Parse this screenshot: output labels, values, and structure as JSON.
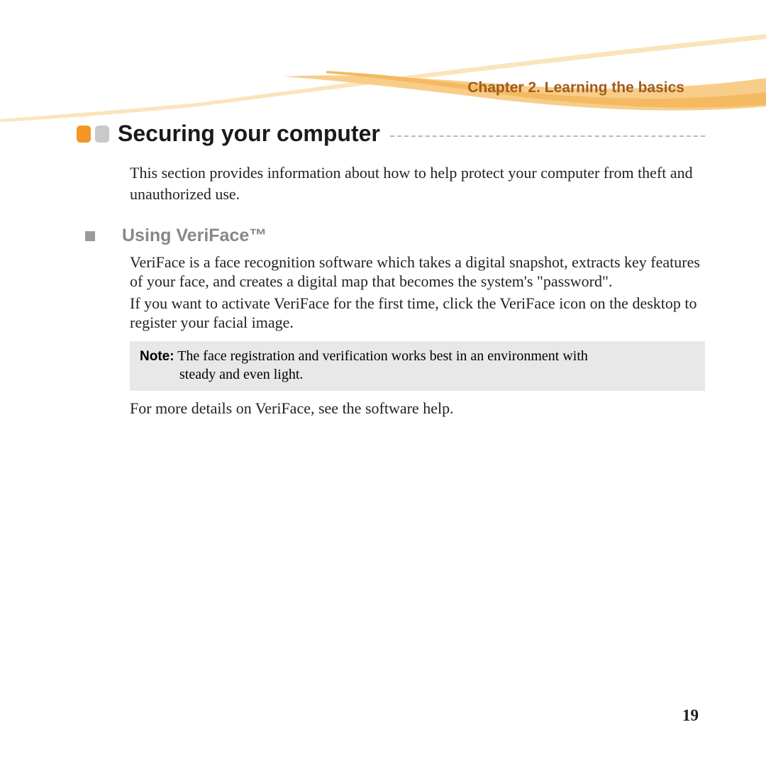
{
  "header": {
    "chapter_title": "Chapter 2. Learning the basics"
  },
  "main": {
    "heading": "Securing your computer",
    "intro": "This section provides information about how to help protect your computer from theft and unauthorized use.",
    "subsection": {
      "heading": "Using VeriFace™",
      "para1": "VeriFace is a face recognition software which takes a digital snapshot, extracts key features of your face, and creates a digital map that becomes the system's \"password\".",
      "para2": "If you want to activate VeriFace for the first time, click the VeriFace icon on the desktop to register your facial image.",
      "note_label": "Note:",
      "note_line1": "The face registration and verification works best in an environment with",
      "note_line2": "steady and even light.",
      "para3": "For more details on VeriFace, see the software help."
    }
  },
  "footer": {
    "page_number": "19"
  }
}
